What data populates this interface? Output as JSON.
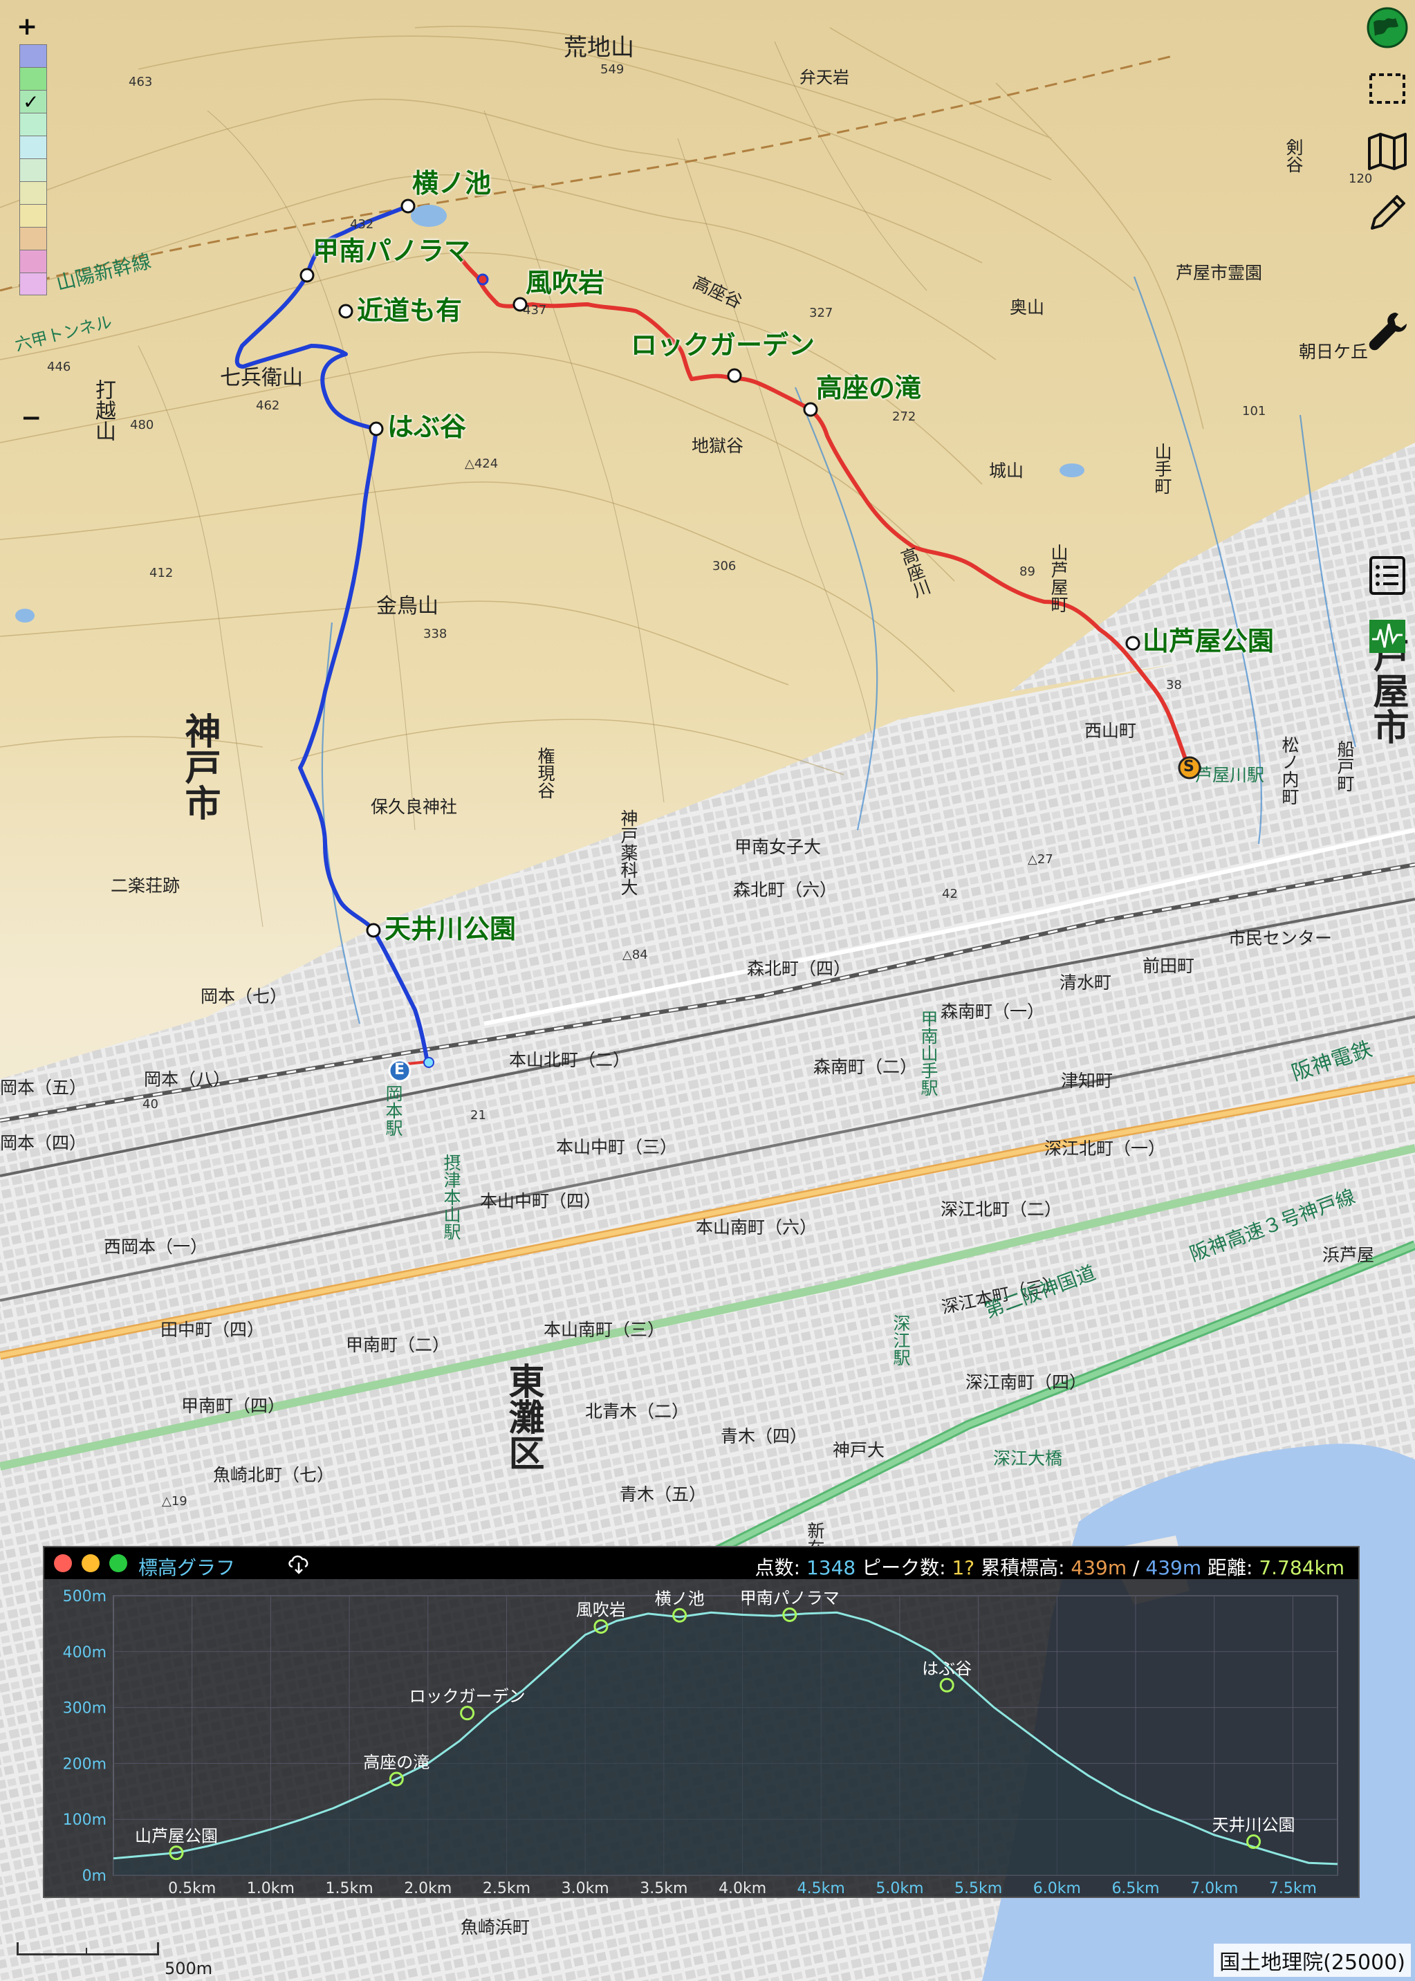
{
  "map": {
    "zoom_in": "+",
    "zoom_out": "−",
    "attribution": "国土地理院(25000)",
    "scale_label": "500m",
    "places": {
      "arajiyama": "荒地山",
      "bentenwa": "弁天岩",
      "okuyama": "奥山",
      "ashiya_cemetery": "芦屋市霊園",
      "asahigaoka": "朝日ケ丘",
      "kenya": "剣谷",
      "takazadani": "高座谷",
      "takaza_ike": "高座ノ滝",
      "jigokudani": "地獄谷",
      "shirayama": "城山",
      "yamate": "山手町",
      "takazagawa": "高座川",
      "yamaashiya_cho": "山芦屋町",
      "shichibee": "七兵衛山",
      "uchikoshi": "打越山",
      "kinchosan": "金鳥山",
      "kobe_city": "神戸市",
      "higashinada": "東灘区",
      "ashiya_city": "芦屋市",
      "nirakuso": "二楽荘跡",
      "hoyoshi": "保久良神社",
      "gongentani": "権現谷",
      "yakka": "神戸薬科大",
      "konan_joshi": "甲南女子大",
      "morikita6": "森北町（六）",
      "morikita4": "森北町（四）",
      "nishiyama": "西山町",
      "ashiyagawa_st": "芦屋川駅",
      "matsunouchi": "松ノ内町",
      "funado": "船戸町",
      "okamoto7": "岡本（七）",
      "okamoto8": "岡本（八）",
      "okamoto5": "岡本（五）",
      "okamoto4": "岡本（四）",
      "okamoto_st": "岡本駅",
      "konan_yamate_st": "甲南山手駅",
      "settsu_motoyama_st": "摂津本山駅",
      "motoyama_kita2": "本山北町（二）",
      "motoyama_naka3": "本山中町（三）",
      "motoyama_naka4": "本山中町（四）",
      "motoyama_minami6": "本山南町（六）",
      "motoyama_minami3": "本山南町（三）",
      "morimi1": "森南町（一）",
      "morimi2": "森南町（二）",
      "fukae_kita1": "深江北町（一）",
      "fukae_kita2": "深江北町（二）",
      "fukae_honmachi3": "深江本町（三）",
      "fukae_minami4": "深江南町（四）",
      "fukae_st": "深江駅",
      "fukae_bridge": "深江大橋",
      "shimin_center": "市民センター",
      "maeda": "前田町",
      "shimizu": "清水町",
      "tsuchi": "津知町",
      "hanshin": "阪神電鉄",
      "kosoku": "阪神高速３号神戸線",
      "kokudo": "第二阪神国道",
      "nishi_okamoto": "西岡本（一）",
      "tanaka4": "田中町（四）",
      "konan4": "甲南町（四）",
      "konan2": "甲南町（二）",
      "uozaki_kita7": "魚崎北町（七）",
      "kita_aoki2": "北青木（二）",
      "aoki4": "青木（四）",
      "aoki5": "青木（五）",
      "kobe_univ": "神戸大",
      "uozaki_hama": "魚崎浜町",
      "sanyo": "山陽新幹線",
      "tunnel": "六甲トンネル",
      "hamabe": "浜芦屋",
      "shinzaike": "新在家"
    },
    "elevations": {
      "e549": "549",
      "e463": "463",
      "e432": "432",
      "e437": "437",
      "e327": "327",
      "e272": "272",
      "e462": "462",
      "e480": "480",
      "e446": "446",
      "e424": "△424",
      "e412": "412",
      "e306": "306",
      "e338": "338",
      "e101": "101",
      "e89": "89",
      "e38": "38",
      "e84": "△84",
      "e42": "42",
      "e27": "△27",
      "e21": "21",
      "e40": "40",
      "e120": "120",
      "e19": "△19"
    },
    "waypoints": {
      "yokonoike": "横ノ池",
      "konan_panorama": "甲南パノラマ",
      "kazafukiiwa": "風吹岩",
      "chikamichi": "近道も有",
      "rock_garden": "ロックガーデン",
      "takaza_falls": "高座の滝",
      "habudani": "はぶ谷",
      "yamaashiya_park": "山芦屋公園",
      "amaigawa_park": "天井川公園"
    },
    "markers": {
      "start": "S",
      "end": "E"
    },
    "colors": {
      "route_climb": "#e2342f",
      "route_descent": "#1f3fd6",
      "waypoint_text": "#0a6e0a"
    }
  },
  "legend": {
    "colors": [
      "#9aa3e6",
      "#8ee08c",
      "#a8e6b4",
      "#bdeecf",
      "#c7ecef",
      "#d2ecd2",
      "#e6e7b4",
      "#efe5a8",
      "#e9c79a",
      "#e6a3d2",
      "#e7b6ea"
    ]
  },
  "tools": [
    "globe-icon",
    "select-rect-icon",
    "map-icon",
    "pencil-icon",
    "wrench-icon",
    "list-icon",
    "elevation-graph-icon"
  ],
  "panel": {
    "title": "標高グラフ",
    "stats": {
      "points_label": "点数:",
      "points": "1348",
      "peaks_label": "ピーク数:",
      "peaks": "1?",
      "gain_label": "累積標高:",
      "gain_up": "439m",
      "sep": "/",
      "gain_down": "439m",
      "distance_label": "距離:",
      "distance": "7.784km"
    },
    "colors": {
      "up": "#e89a4c",
      "down": "#6aa6f0",
      "points": "#63c8ef",
      "peaks": "#f2d14a",
      "distance": "#c9f56a"
    }
  },
  "chart_data": {
    "type": "area",
    "x_unit": "km",
    "y_unit": "m",
    "xlim": [
      0,
      7.784
    ],
    "ylim": [
      0,
      500
    ],
    "x_ticks": [
      "0.5km",
      "1.0km",
      "1.5km",
      "2.0km",
      "2.5km",
      "3.0km",
      "3.5km",
      "4.0km",
      "4.5km",
      "5.0km",
      "5.5km",
      "6.0km",
      "6.5km",
      "7.0km",
      "7.5km"
    ],
    "y_ticks": [
      "0m",
      "100m",
      "200m",
      "300m",
      "400m",
      "500m"
    ],
    "x": [
      0,
      0.2,
      0.4,
      0.6,
      0.8,
      1.0,
      1.2,
      1.4,
      1.6,
      1.8,
      2.0,
      2.2,
      2.4,
      2.6,
      2.8,
      3.0,
      3.2,
      3.4,
      3.6,
      3.8,
      4.0,
      4.2,
      4.4,
      4.6,
      4.8,
      5.0,
      5.2,
      5.4,
      5.6,
      5.8,
      6.0,
      6.2,
      6.4,
      6.6,
      6.8,
      7.0,
      7.2,
      7.4,
      7.6,
      7.784
    ],
    "y": [
      30,
      35,
      40,
      52,
      66,
      82,
      100,
      120,
      145,
      172,
      200,
      240,
      290,
      330,
      380,
      430,
      455,
      468,
      462,
      470,
      466,
      464,
      468,
      470,
      455,
      430,
      400,
      350,
      300,
      258,
      216,
      178,
      145,
      118,
      96,
      72,
      55,
      38,
      22,
      20
    ],
    "waypoints": [
      {
        "label": "山芦屋公園",
        "x": 0.4,
        "y": 40
      },
      {
        "label": "高座の滝",
        "x": 1.8,
        "y": 172
      },
      {
        "label": "ロックガーデン",
        "x": 2.25,
        "y": 290
      },
      {
        "label": "風吹岩",
        "x": 3.1,
        "y": 445
      },
      {
        "label": "横ノ池",
        "x": 3.6,
        "y": 465
      },
      {
        "label": "甲南パノラマ",
        "x": 4.3,
        "y": 466
      },
      {
        "label": "はぶ谷",
        "x": 5.3,
        "y": 340
      },
      {
        "label": "天井川公園",
        "x": 7.25,
        "y": 60
      }
    ]
  }
}
